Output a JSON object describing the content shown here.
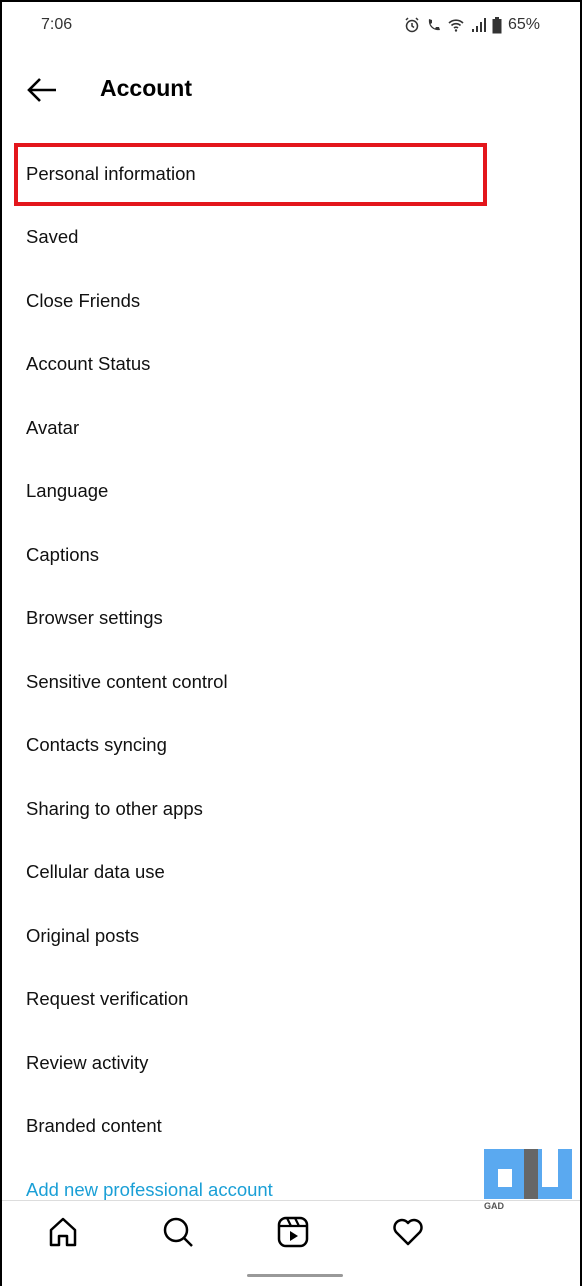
{
  "status_bar": {
    "time": "7:06",
    "battery": "65%",
    "icons": [
      "alarm-icon",
      "wifi-call-icon",
      "wifi-icon",
      "signal-icon",
      "battery-icon"
    ]
  },
  "header": {
    "title": "Account",
    "back_icon": "arrow-left-icon"
  },
  "items": [
    {
      "label": "Personal information",
      "highlighted": true
    },
    {
      "label": "Saved"
    },
    {
      "label": "Close Friends"
    },
    {
      "label": "Account Status"
    },
    {
      "label": "Avatar"
    },
    {
      "label": "Language"
    },
    {
      "label": "Captions"
    },
    {
      "label": "Browser settings"
    },
    {
      "label": "Sensitive content control"
    },
    {
      "label": "Contacts syncing"
    },
    {
      "label": "Sharing to other apps"
    },
    {
      "label": "Cellular data use"
    },
    {
      "label": "Original posts"
    },
    {
      "label": "Request verification"
    },
    {
      "label": "Review activity"
    },
    {
      "label": "Branded content"
    },
    {
      "label": "Add new professional account"
    }
  ],
  "colors": {
    "link": "#1a9fd6",
    "highlight": "#e3161c"
  },
  "nav": [
    "home-icon",
    "search-icon",
    "reels-icon",
    "heart-icon"
  ],
  "watermark": "GADGETS TO USE"
}
